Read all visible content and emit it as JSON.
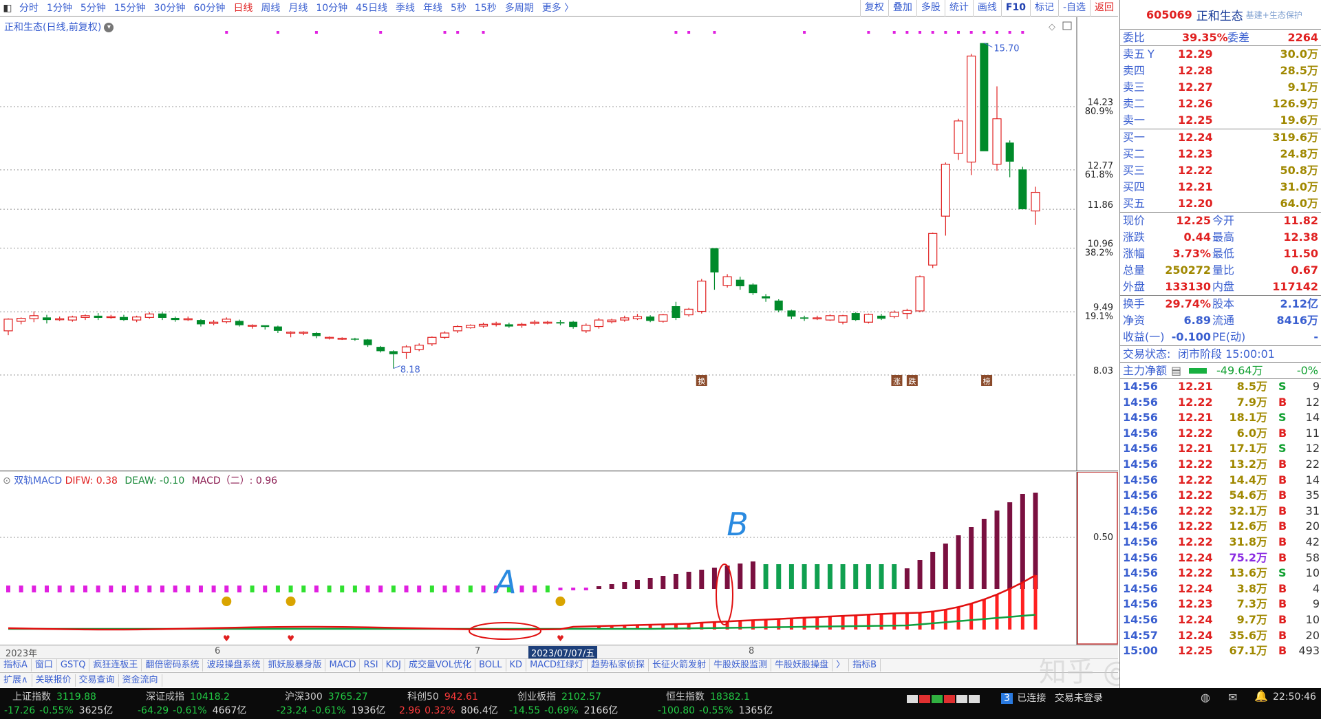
{
  "topbar": {
    "periods": [
      "分时",
      "1分钟",
      "5分钟",
      "15分钟",
      "30分钟",
      "60分钟",
      "日线",
      "周线",
      "月线",
      "10分钟",
      "45日线",
      "季线",
      "年线",
      "5秒",
      "15秒",
      "多周期",
      "更多 〉"
    ],
    "active_period": "日线",
    "tools": [
      "复权",
      "叠加",
      "多股",
      "统计",
      "画线",
      "F10",
      "标记",
      "-自选",
      "返回"
    ]
  },
  "main_chart": {
    "title": "正和生态(日线,前复权)",
    "price_labels": [
      {
        "price": "14.23",
        "pct": "80.9%"
      },
      {
        "price": "12.77",
        "pct": "61.8%"
      },
      {
        "price": "11.86",
        "pct": ""
      },
      {
        "price": "10.96",
        "pct": "38.2%"
      },
      {
        "price": "9.49",
        "pct": "19.1%"
      },
      {
        "price": "8.03",
        "pct": ""
      }
    ],
    "high_marker": "15.70",
    "low_marker": "8.18",
    "event_tags": [
      "换",
      "涨",
      "跌",
      "榜"
    ]
  },
  "chart_data": {
    "type": "candlestick",
    "title": "正和生态(日线,前复权)",
    "ylim": [
      8.03,
      15.9
    ],
    "y_ticks": [
      8.03,
      9.49,
      10.96,
      11.86,
      12.77,
      14.23
    ],
    "candles": [
      [
        9.05,
        9.32,
        9.34,
        8.95
      ],
      [
        9.27,
        9.34,
        9.36,
        9.2
      ],
      [
        9.33,
        9.4,
        9.5,
        9.25
      ],
      [
        9.36,
        9.3,
        9.42,
        9.22
      ],
      [
        9.33,
        9.33,
        9.38,
        9.28
      ],
      [
        9.3,
        9.37,
        9.4,
        9.26
      ],
      [
        9.36,
        9.4,
        9.43,
        9.3
      ],
      [
        9.4,
        9.35,
        9.46,
        9.3
      ],
      [
        9.38,
        9.38,
        9.42,
        9.33
      ],
      [
        9.37,
        9.3,
        9.42,
        9.28
      ],
      [
        9.3,
        9.37,
        9.4,
        9.25
      ],
      [
        9.36,
        9.44,
        9.48,
        9.33
      ],
      [
        9.45,
        9.35,
        9.48,
        9.3
      ],
      [
        9.35,
        9.3,
        9.38,
        9.26
      ],
      [
        9.32,
        9.33,
        9.38,
        9.28
      ],
      [
        9.3,
        9.2,
        9.32,
        9.15
      ],
      [
        9.22,
        9.25,
        9.3,
        9.18
      ],
      [
        9.26,
        9.32,
        9.36,
        9.22
      ],
      [
        9.28,
        9.18,
        9.31,
        9.15
      ],
      [
        9.18,
        9.18,
        9.2,
        9.1
      ],
      [
        9.18,
        9.14,
        9.18,
        9.08
      ],
      [
        9.15,
        9.05,
        9.17,
        9.0
      ],
      [
        9.02,
        9.02,
        9.04,
        8.9
      ],
      [
        9.02,
        9.02,
        9.04,
        8.95
      ],
      [
        9.0,
        8.93,
        9.02,
        8.88
      ],
      [
        8.9,
        8.9,
        8.92,
        8.85
      ],
      [
        8.88,
        8.88,
        8.9,
        8.84
      ],
      [
        8.87,
        8.85,
        8.89,
        8.82
      ],
      [
        8.85,
        8.72,
        8.86,
        8.68
      ],
      [
        8.68,
        8.58,
        8.7,
        8.55
      ],
      [
        8.58,
        8.51,
        8.6,
        8.18
      ],
      [
        8.55,
        8.68,
        8.72,
        8.4
      ],
      [
        8.62,
        8.72,
        8.76,
        8.58
      ],
      [
        8.75,
        8.9,
        8.92,
        8.7
      ],
      [
        8.9,
        9.0,
        9.04,
        8.86
      ],
      [
        9.05,
        9.15,
        9.18,
        9.0
      ],
      [
        9.12,
        9.18,
        9.2,
        9.1
      ],
      [
        9.16,
        9.2,
        9.24,
        9.12
      ],
      [
        9.2,
        9.22,
        9.26,
        9.15
      ],
      [
        9.2,
        9.15,
        9.24,
        9.12
      ],
      [
        9.17,
        9.2,
        9.24,
        9.12
      ],
      [
        9.22,
        9.25,
        9.3,
        9.18
      ],
      [
        9.25,
        9.25,
        9.28,
        9.2
      ],
      [
        9.25,
        9.22,
        9.3,
        9.18
      ],
      [
        9.26,
        9.14,
        9.28,
        9.1
      ],
      [
        9.05,
        9.18,
        9.22,
        9.0
      ],
      [
        9.15,
        9.3,
        9.35,
        9.1
      ],
      [
        9.26,
        9.3,
        9.33,
        9.22
      ],
      [
        9.3,
        9.35,
        9.4,
        9.26
      ],
      [
        9.33,
        9.38,
        9.44,
        9.3
      ],
      [
        9.38,
        9.28,
        9.41,
        9.25
      ],
      [
        9.27,
        9.42,
        9.44,
        9.24
      ],
      [
        9.62,
        9.35,
        9.72,
        9.3
      ],
      [
        9.42,
        9.55,
        9.58,
        9.38
      ],
      [
        9.5,
        10.2,
        10.25,
        9.45
      ],
      [
        10.96,
        10.4,
        10.96,
        10.0
      ],
      [
        10.1,
        10.3,
        10.36,
        10.05
      ],
      [
        10.23,
        10.08,
        10.3,
        10.0
      ],
      [
        10.12,
        9.92,
        10.15,
        9.88
      ],
      [
        9.85,
        9.8,
        9.9,
        9.72
      ],
      [
        9.75,
        9.52,
        9.78,
        9.48
      ],
      [
        9.52,
        9.38,
        9.54,
        9.32
      ],
      [
        9.36,
        9.33,
        9.4,
        9.28
      ],
      [
        9.33,
        9.35,
        9.4,
        9.3
      ],
      [
        9.3,
        9.4,
        9.43,
        9.28
      ],
      [
        9.25,
        9.4,
        9.42,
        9.2
      ],
      [
        9.46,
        9.3,
        9.48,
        9.28
      ],
      [
        9.25,
        9.43,
        9.45,
        9.22
      ],
      [
        9.4,
        9.33,
        9.44,
        9.3
      ],
      [
        9.38,
        9.48,
        9.52,
        9.34
      ],
      [
        9.45,
        9.52,
        9.56,
        9.32
      ],
      [
        9.51,
        10.3,
        10.33,
        9.48
      ],
      [
        10.57,
        11.3,
        11.32,
        10.5
      ],
      [
        11.7,
        12.9,
        12.94,
        11.25
      ],
      [
        13.15,
        13.9,
        13.95,
        13.0
      ],
      [
        12.95,
        15.4,
        15.45,
        12.65
      ],
      [
        15.7,
        13.2,
        15.7,
        13.2
      ],
      [
        12.9,
        13.95,
        14.7,
        12.75
      ],
      [
        13.4,
        12.96,
        13.45,
        12.6
      ],
      [
        12.78,
        11.86,
        12.84,
        11.86
      ],
      [
        11.82,
        12.25,
        12.38,
        11.5
      ]
    ],
    "macd_panel": {
      "title": "双轨MACD",
      "difw": "0.38",
      "deaw": "-0.10",
      "macd": "0.96",
      "level": "0.50"
    }
  },
  "macd_labels": {
    "prefix": "双轨MACD",
    "difw": "DIFW: 0.38",
    "deaw": "DEAW: -0.10",
    "macd": "MACD（二）: 0.96",
    "level": "0.50",
    "annot_a": "A",
    "annot_b": "B"
  },
  "date_axis": {
    "year": "2023年",
    "m6": "6",
    "m7": "7",
    "cursor": "2023/07/07/五",
    "m8": "8"
  },
  "tabs1": [
    "指标A",
    "窗口",
    "GSTQ",
    "疯狂连板王",
    "翻倍密码系统",
    "波段操盘系统",
    "抓妖股暴身版",
    "MACD",
    "RSI",
    "KDJ",
    "成交量VOL优化",
    "BOLL",
    "KD",
    "MACD红绿灯",
    "趋势私家侦探",
    "长征火箭发射",
    "牛股妖股监测",
    "牛股妖股操盘",
    "〉",
    "指标B"
  ],
  "tabs2": [
    "扩展∧",
    "关联报价",
    "交易查询",
    "资金流向"
  ],
  "status": {
    "indices": [
      {
        "name": "上证指数",
        "value": "3119.88",
        "chg": "-17.26",
        "pct": "-0.55%",
        "amt": "3625亿"
      },
      {
        "name": "深证成指",
        "value": "10418.2",
        "chg": "-64.29",
        "pct": "-0.61%",
        "amt": "4667亿"
      },
      {
        "name": "沪深300",
        "value": "3765.27",
        "chg": "-23.24",
        "pct": "-0.61%",
        "amt": "1936亿"
      },
      {
        "name": "科创50",
        "value": "942.61",
        "chg": "2.96",
        "pct": "0.32%",
        "amt": "806.4亿"
      },
      {
        "name": "创业板指",
        "value": "2102.57",
        "chg": "-14.55",
        "pct": "-0.69%",
        "amt": "2166亿"
      },
      {
        "name": "恒生指数",
        "value": "18382.1",
        "chg": "-100.80",
        "pct": "-0.55%",
        "amt": "1365亿"
      }
    ],
    "connected": "已连接",
    "conn_count": "3",
    "login": "交易未登录",
    "time": "22:50:46"
  },
  "quote": {
    "code": "605069",
    "name": "正和生态",
    "tag": "基建+生态保护",
    "wb_label": "委比",
    "wb": "39.35%",
    "wc_label": "委差",
    "wc": "2264",
    "asks": [
      {
        "label": "卖五",
        "flag": "Y",
        "price": "12.29",
        "vol": "30.0万"
      },
      {
        "label": "卖四",
        "price": "12.28",
        "vol": "28.5万"
      },
      {
        "label": "卖三",
        "price": "12.27",
        "vol": "9.1万"
      },
      {
        "label": "卖二",
        "price": "12.26",
        "vol": "126.9万"
      },
      {
        "label": "卖一",
        "price": "12.25",
        "vol": "19.6万"
      }
    ],
    "bids": [
      {
        "label": "买一",
        "price": "12.24",
        "vol": "319.6万"
      },
      {
        "label": "买二",
        "price": "12.23",
        "vol": "24.8万"
      },
      {
        "label": "买三",
        "price": "12.22",
        "vol": "50.8万"
      },
      {
        "label": "买四",
        "price": "12.21",
        "vol": "31.0万"
      },
      {
        "label": "买五",
        "price": "12.20",
        "vol": "64.0万"
      }
    ],
    "stats": [
      {
        "l1": "现价",
        "v1": "12.25",
        "c1": "red",
        "l2": "今开",
        "v2": "11.82",
        "c2": "red"
      },
      {
        "l1": "涨跌",
        "v1": "0.44",
        "c1": "red",
        "l2": "最高",
        "v2": "12.38",
        "c2": "red"
      },
      {
        "l1": "涨幅",
        "v1": "3.73%",
        "c1": "red",
        "l2": "最低",
        "v2": "11.50",
        "c2": "red"
      },
      {
        "l1": "总量",
        "v1": "250272",
        "c1": "olive",
        "l2": "量比",
        "v2": "0.67",
        "c2": "red"
      },
      {
        "l1": "外盘",
        "v1": "133130",
        "c1": "red",
        "l2": "内盘",
        "v2": "117142",
        "c2": "red"
      }
    ],
    "stats2": [
      {
        "l1": "换手",
        "v1": "29.74%",
        "c1": "red",
        "l2": "股本",
        "v2": "2.12亿",
        "c2": "blue"
      },
      {
        "l1": "净资",
        "v1": "6.89",
        "c1": "blue",
        "l2": "流通",
        "v2": "8416万",
        "c2": "blue"
      },
      {
        "l1": "收益(一)",
        "v1": "-0.100",
        "c1": "blue",
        "l2": "PE(动)",
        "v2": "-",
        "c2": "blue"
      }
    ],
    "trade_state_label": "交易状态:",
    "trade_state": "闭市阶段 15:00:01",
    "main_flow_label": "主力净额",
    "main_flow": "-49.64万",
    "main_flow_pct": "-0%"
  },
  "ticks": [
    {
      "t": "14:56",
      "p": "12.21",
      "v": "8.5万",
      "bs": "S",
      "n": "9"
    },
    {
      "t": "14:56",
      "p": "12.22",
      "v": "7.9万",
      "bs": "B",
      "n": "12"
    },
    {
      "t": "14:56",
      "p": "12.21",
      "v": "18.1万",
      "bs": "S",
      "n": "14"
    },
    {
      "t": "14:56",
      "p": "12.22",
      "v": "6.0万",
      "bs": "B",
      "n": "11"
    },
    {
      "t": "14:56",
      "p": "12.21",
      "v": "17.1万",
      "bs": "S",
      "n": "12"
    },
    {
      "t": "14:56",
      "p": "12.22",
      "v": "13.2万",
      "bs": "B",
      "n": "22"
    },
    {
      "t": "14:56",
      "p": "12.22",
      "v": "14.4万",
      "bs": "B",
      "n": "14"
    },
    {
      "t": "14:56",
      "p": "12.22",
      "v": "54.6万",
      "bs": "B",
      "n": "35"
    },
    {
      "t": "14:56",
      "p": "12.22",
      "v": "32.1万",
      "bs": "B",
      "n": "31"
    },
    {
      "t": "14:56",
      "p": "12.22",
      "v": "12.6万",
      "bs": "B",
      "n": "20"
    },
    {
      "t": "14:56",
      "p": "12.22",
      "v": "31.8万",
      "bs": "B",
      "n": "42"
    },
    {
      "t": "14:56",
      "p": "12.24",
      "v": "75.2万",
      "bs": "B",
      "n": "58"
    },
    {
      "t": "14:56",
      "p": "12.22",
      "v": "13.6万",
      "bs": "S",
      "n": "10"
    },
    {
      "t": "14:56",
      "p": "12.24",
      "v": "3.8万",
      "bs": "B",
      "n": "4"
    },
    {
      "t": "14:56",
      "p": "12.23",
      "v": "7.3万",
      "bs": "B",
      "n": "9"
    },
    {
      "t": "14:56",
      "p": "12.24",
      "v": "9.7万",
      "bs": "B",
      "n": "10"
    },
    {
      "t": "14:57",
      "p": "12.24",
      "v": "35.6万",
      "bs": "B",
      "n": "20"
    },
    {
      "t": "15:00",
      "p": "12.25",
      "v": "67.1万",
      "bs": "B",
      "n": "493"
    }
  ],
  "watermark": "知乎 @孟飞云",
  "colors": {
    "up": "#e02020",
    "down": "#008a2a",
    "macd_up": "#7a1040",
    "macd_dn": "#10a050",
    "accent": "#3a5fd0"
  }
}
